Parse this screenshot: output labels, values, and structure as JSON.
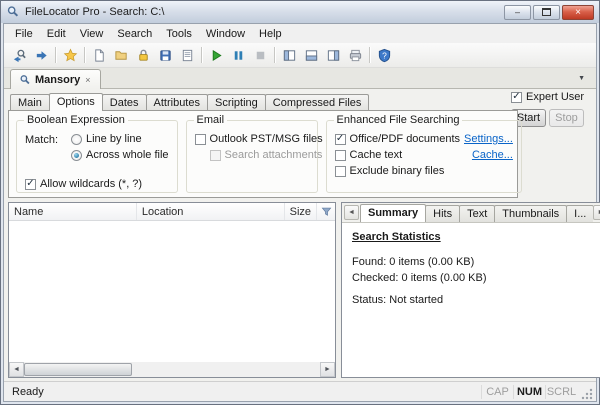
{
  "glyphs": {
    "minimize": "–",
    "close": "×",
    "dropdown": "▼",
    "scroll_left": "◄",
    "scroll_right": "►"
  },
  "window": {
    "title": "FileLocator Pro - Search: C:\\"
  },
  "menu": {
    "items": [
      "File",
      "Edit",
      "View",
      "Search",
      "Tools",
      "Window",
      "Help"
    ]
  },
  "toolbar": {
    "icons": [
      "back",
      "forward",
      "favorites",
      "new-document",
      "open",
      "lock",
      "save",
      "report",
      "start-search",
      "pause-search",
      "stop-search",
      "layout-left",
      "layout-bottom",
      "layout-right",
      "print",
      "help"
    ]
  },
  "document_tabs": {
    "active_label": "Mansory"
  },
  "search_tabs": {
    "items": [
      "Main",
      "Options",
      "Dates",
      "Attributes",
      "Scripting",
      "Compressed Files"
    ],
    "active": "Options"
  },
  "expert_user": {
    "label": "Expert User",
    "checked": true
  },
  "actions": {
    "start": "Start",
    "stop": "Stop",
    "stop_enabled": false
  },
  "options": {
    "boolean_expression": {
      "title": "Boolean Expression",
      "match_label": "Match:",
      "radio_line_by_line": "Line by line",
      "line_by_line_selected": false,
      "radio_across_whole_file": "Across whole file",
      "across_whole_file_selected": true,
      "wildcards_label": "Allow wildcards (*, ?)",
      "wildcards_checked": true
    },
    "email": {
      "title": "Email",
      "outlook_label": "Outlook PST/MSG files",
      "outlook_checked": false,
      "attachments_label": "Search attachments",
      "attachments_checked": false,
      "attachments_enabled": false
    },
    "enhanced": {
      "title": "Enhanced File Searching",
      "office_label": "Office/PDF documents",
      "office_checked": true,
      "settings_link": "Settings...",
      "cache_label": "Cache text",
      "cache_checked": false,
      "cache_link": "Cache...",
      "exclude_label": "Exclude binary files",
      "exclude_checked": false
    }
  },
  "results": {
    "columns": [
      "Name",
      "Location",
      "Size"
    ]
  },
  "preview": {
    "tabs": [
      "Summary",
      "Hits",
      "Text",
      "Thumbnails",
      "I..."
    ],
    "active": "Summary",
    "summary": {
      "heading": "Search Statistics",
      "found": "Found: 0 items (0.00 KB)",
      "checked": "Checked: 0 items (0.00 KB)",
      "status": "Status: Not started"
    }
  },
  "status_bar": {
    "ready": "Ready",
    "indicators": [
      "CAP",
      "NUM",
      "SCRL"
    ],
    "num_active": true
  }
}
